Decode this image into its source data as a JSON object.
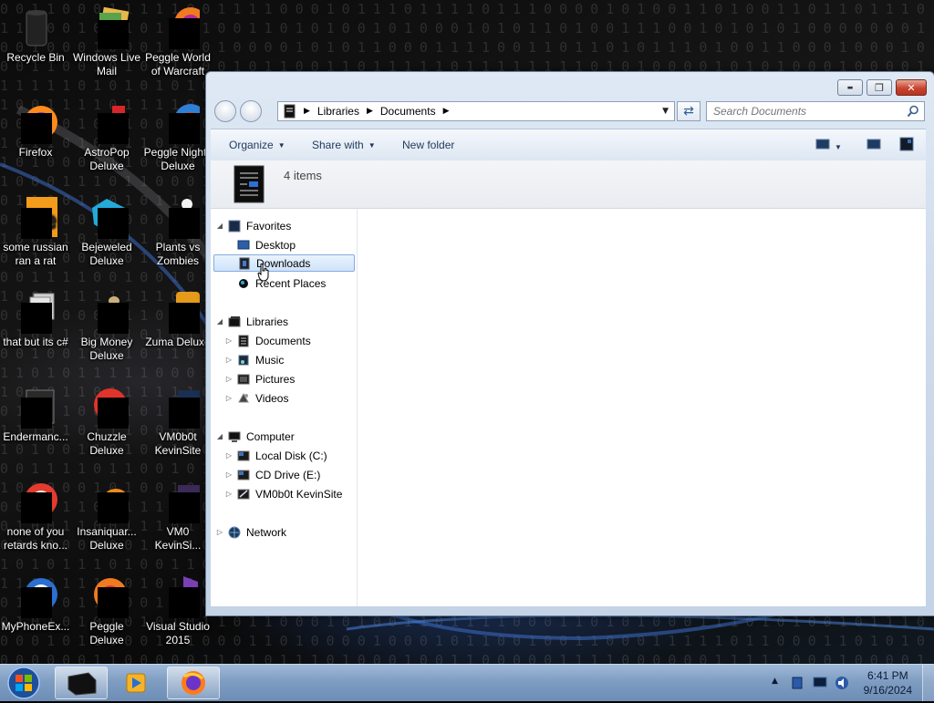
{
  "desktop": {
    "icons": [
      {
        "label": "Recycle Bin",
        "icon": "recycle-bin-icon"
      },
      {
        "label": "Windows Live Mail",
        "icon": "windows-live-mail-icon"
      },
      {
        "label": "Peggle World of Warcraft",
        "icon": "peggle-icon"
      },
      {
        "label": "Firefox",
        "icon": "firefox-icon"
      },
      {
        "label": "AstroPop Deluxe",
        "icon": "astropop-icon"
      },
      {
        "label": "Peggle Nights Deluxe",
        "icon": "peggle-nights-icon"
      },
      {
        "label": "some russian ran a rat",
        "icon": "app-icon"
      },
      {
        "label": "Bejeweled Deluxe",
        "icon": "bejeweled-icon"
      },
      {
        "label": "Plants vs Zombies",
        "icon": "plants-vs-zombies-icon"
      },
      {
        "label": "that but its c#",
        "icon": "app-icon"
      },
      {
        "label": "Big Money Deluxe",
        "icon": "big-money-icon"
      },
      {
        "label": "Zuma Deluxe",
        "icon": "zuma-icon"
      },
      {
        "label": "Endermanc...",
        "icon": "app-icon"
      },
      {
        "label": "Chuzzle Deluxe",
        "icon": "chuzzle-icon"
      },
      {
        "label": "VM0b0t KevinSite",
        "icon": "app-icon"
      },
      {
        "label": "none of you retards kno...",
        "icon": "app-icon"
      },
      {
        "label": "Insaniquar... Deluxe",
        "icon": "insaniquarium-icon"
      },
      {
        "label": "VM0 KevinSi...",
        "icon": "app-icon"
      },
      {
        "label": "MyPhoneEx...",
        "icon": "app-icon"
      },
      {
        "label": "Peggle Deluxe",
        "icon": "peggle-icon"
      },
      {
        "label": "Visual Studio 2015",
        "icon": "visual-studio-icon"
      }
    ]
  },
  "window": {
    "title_buttons": {
      "minimize": "▬",
      "maximize": "❐",
      "close": "✕"
    },
    "address": {
      "crumbs": [
        "Libraries",
        "Documents"
      ]
    },
    "search": {
      "placeholder": "Search Documents"
    },
    "toolbar": {
      "organize": "Organize",
      "share_with": "Share with",
      "new_folder": "New folder"
    },
    "details": {
      "count": "4 items"
    },
    "nav": {
      "favorites": "Favorites",
      "desktop": "Desktop",
      "downloads": "Downloads",
      "recent_places": "Recent Places",
      "libraries": "Libraries",
      "documents": "Documents",
      "music": "Music",
      "pictures": "Pictures",
      "videos": "Videos",
      "computer": "Computer",
      "local_disk": "Local Disk (C:)",
      "cd_drive": "CD Drive (E:)",
      "vm_site": "VM0b0t KevinSite",
      "network": "Network"
    }
  },
  "taskbar": {
    "clock": {
      "time": "6:41 PM",
      "date": "9/16/2024"
    }
  }
}
